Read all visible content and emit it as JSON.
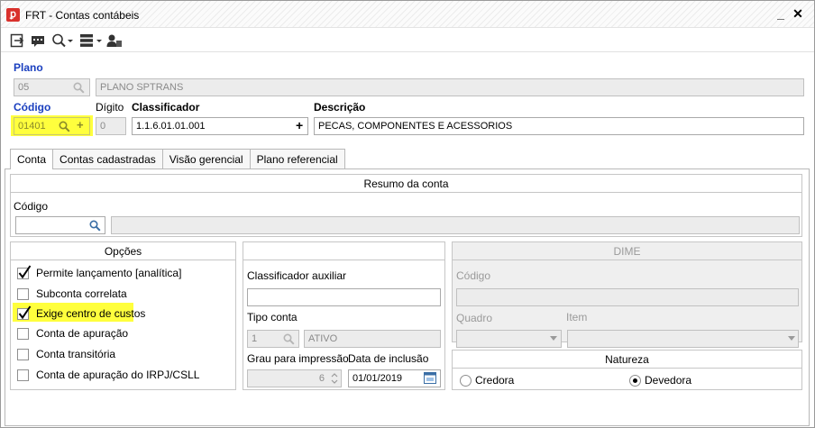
{
  "window": {
    "title": "FRT - Contas contábeis"
  },
  "plano": {
    "label": "Plano",
    "code": "05",
    "name": "PLANO SPTRANS"
  },
  "codigo": {
    "label": "Código",
    "value": "01401"
  },
  "digito": {
    "label": "Dígito",
    "value": "0"
  },
  "classificador": {
    "label": "Classificador",
    "value": "1.1.6.01.01.001"
  },
  "descricao": {
    "label": "Descrição",
    "value": "PECAS, COMPONENTES E ACESSORIOS"
  },
  "tabs": [
    {
      "label": "Conta"
    },
    {
      "label": "Contas cadastradas"
    },
    {
      "label": "Visão gerencial"
    },
    {
      "label": "Plano referencial"
    }
  ],
  "resumo": {
    "title": "Resumo da conta",
    "codigo_label": "Código",
    "codigo_value": "",
    "descricao_value": ""
  },
  "opcoes": {
    "title": "Opções",
    "items": [
      {
        "label": "Permite lançamento [analítica]",
        "checked": true
      },
      {
        "label": "Subconta correlata",
        "checked": false
      },
      {
        "label": "Exige centro de custos",
        "checked": true
      },
      {
        "label": "Conta de apuração",
        "checked": false
      },
      {
        "label": "Conta transitória",
        "checked": false
      },
      {
        "label": "Conta de apuração do IRPJ/CSLL",
        "checked": false
      }
    ]
  },
  "middle": {
    "classificador_aux_label": "Classificador auxiliar",
    "classificador_aux_value": "",
    "tipo_conta_label": "Tipo conta",
    "tipo_conta_code": "1",
    "tipo_conta_name": "ATIVO",
    "grau_label": "Grau para impressão",
    "grau_value": "6",
    "data_inclusao_label": "Data de inclusão",
    "data_inclusao_value": "01/01/2019"
  },
  "dime": {
    "title": "DIME",
    "codigo_label": "Código",
    "quadro_label": "Quadro",
    "item_label": "Item"
  },
  "natureza": {
    "title": "Natureza",
    "options": [
      {
        "label": "Credora",
        "selected": false
      },
      {
        "label": "Devedora",
        "selected": true
      }
    ]
  },
  "colors": {
    "highlight": "#ffff3d",
    "accent_blue": "#1a3fbf",
    "app_icon": "#d9312c"
  },
  "icons": [
    "exit-icon",
    "message-icon",
    "search-icon",
    "list-icon",
    "user-icon"
  ]
}
